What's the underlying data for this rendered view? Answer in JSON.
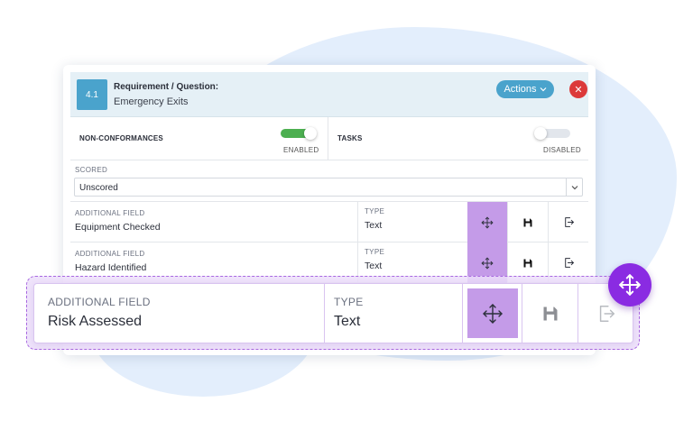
{
  "requirement": {
    "number": "4.1",
    "title": "Requirement / Question:",
    "subtitle": "Emergency Exits",
    "actions_label": "Actions",
    "close_symbol": "✕"
  },
  "toggles": {
    "non_conformances": {
      "label": "NON-CONFORMANCES",
      "state": "ENABLED"
    },
    "tasks": {
      "label": "TASKS",
      "state": "DISABLED"
    }
  },
  "scored": {
    "label": "SCORED",
    "value": "Unscored"
  },
  "fields": [
    {
      "label": "ADDITIONAL FIELD",
      "value": "Equipment Checked",
      "type_label": "TYPE",
      "type_value": "Text"
    },
    {
      "label": "ADDITIONAL FIELD",
      "value": "Hazard Identified",
      "type_label": "TYPE",
      "type_value": "Text"
    }
  ],
  "dragged_field": {
    "label": "ADDITIONAL FIELD",
    "value": "Risk Assessed",
    "type_label": "TYPE",
    "type_value": "Text"
  },
  "icons": {
    "move": "move-arrows-icon",
    "save": "save-floppy-icon",
    "exit": "exit-icon",
    "chevron": "chevron-down-icon",
    "close": "close-icon"
  },
  "colors": {
    "header_bg": "#e5f0f6",
    "accent_blue": "#4aa3cc",
    "close_red": "#dc3a3a",
    "toggle_on": "#4caf50",
    "move_purple": "#c49be8",
    "handle_purple": "#8a2be2",
    "drag_outline": "#a867e0"
  }
}
